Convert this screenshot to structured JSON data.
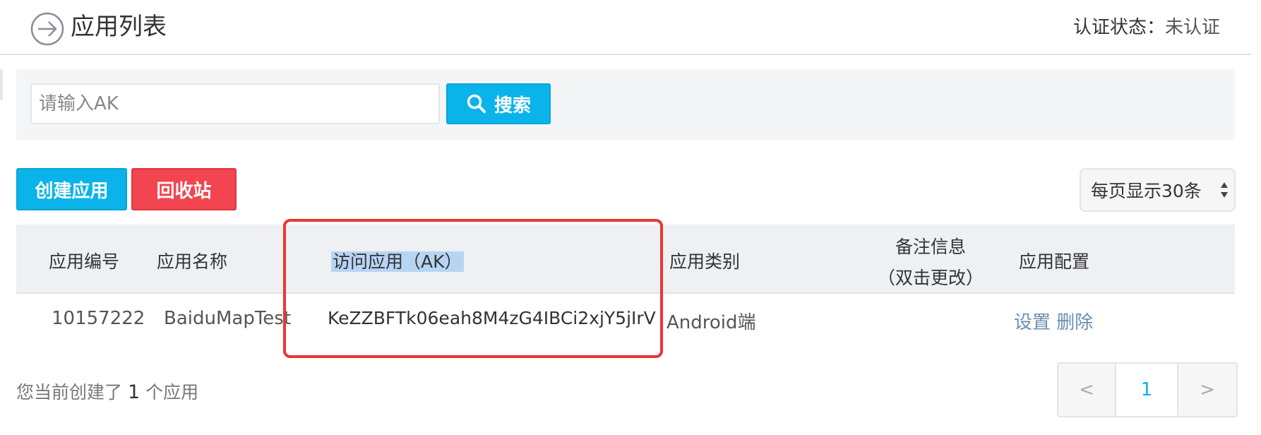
{
  "header": {
    "title": "应用列表",
    "cert_label": "认证状态：",
    "cert_value": "未认证"
  },
  "search": {
    "placeholder": "请输入AK",
    "button_label": "搜索"
  },
  "actions": {
    "create_label": "创建应用",
    "recycle_label": "回收站"
  },
  "per_page": {
    "selected": "每页显示30条"
  },
  "table": {
    "headers": {
      "id": "应用编号",
      "name": "应用名称",
      "ak": "访问应用（AK）",
      "type": "应用类别",
      "note_line1": "备注信息",
      "note_line2": "（双击更改）",
      "config": "应用配置"
    },
    "rows": [
      {
        "id": "10157222",
        "name": "BaiduMapTest",
        "ak": "KeZZBFTk06eah8M4zG4IBCi2xjY5jIrV",
        "type": "Android端",
        "note": "",
        "settings_label": "设置",
        "delete_label": "删除"
      }
    ]
  },
  "summary": {
    "prefix": "您当前创建了",
    "count": "1",
    "suffix": "个应用"
  },
  "pagination": {
    "prev": "<",
    "current": "1",
    "next": ">"
  },
  "colors": {
    "primary": "#0ab4ea",
    "danger": "#f2454f",
    "highlight": "#ef3434"
  }
}
